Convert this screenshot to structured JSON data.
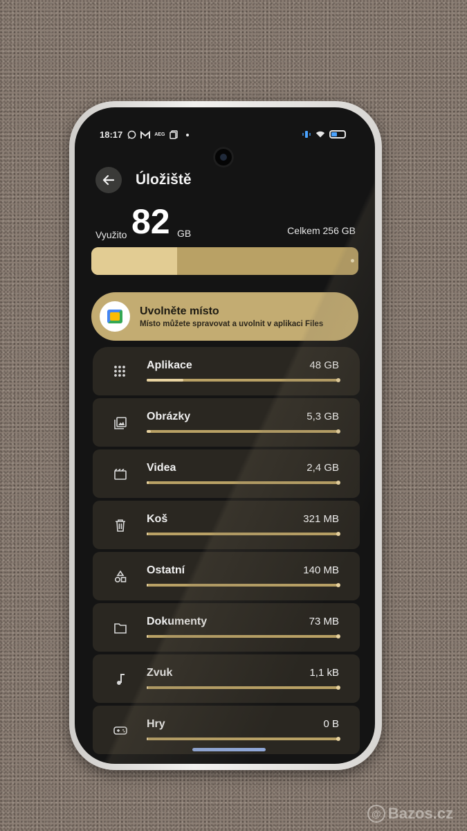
{
  "status_bar": {
    "time": "18:17",
    "left_icons": [
      "whatsapp-icon",
      "gmail-icon",
      "aeg-icon",
      "copy-icon",
      "dot-icon"
    ],
    "aeg_label": "AEG",
    "right_icons": [
      "vibrate-icon",
      "wifi-icon",
      "battery-icon"
    ]
  },
  "header": {
    "title": "Úložiště",
    "back_icon": "arrow-left-icon"
  },
  "storage": {
    "used_label": "Využito",
    "used_value": "82",
    "used_unit": "GB",
    "total_text": "Celkem 256 GB",
    "used_fraction": 0.32
  },
  "promo": {
    "title": "Uvolněte místo",
    "subtitle": "Místo můžete spravovat a uvolnit v aplikaci Files",
    "icon": "files-app-icon"
  },
  "categories": [
    {
      "name": "Aplikace",
      "size": "48 GB",
      "icon": "apps-grid-icon",
      "fraction": 0.19
    },
    {
      "name": "Obrázky",
      "size": "5,3 GB",
      "icon": "images-icon",
      "fraction": 0.02
    },
    {
      "name": "Videa",
      "size": "2,4 GB",
      "icon": "video-icon",
      "fraction": 0.01
    },
    {
      "name": "Koš",
      "size": "321 MB",
      "icon": "trash-icon",
      "fraction": 0.0
    },
    {
      "name": "Ostatní",
      "size": "140 MB",
      "icon": "shapes-icon",
      "fraction": 0.0
    },
    {
      "name": "Dokumenty",
      "size": "73 MB",
      "icon": "folder-icon",
      "fraction": 0.0
    },
    {
      "name": "Zvuk",
      "size": "1,1 kB",
      "icon": "music-note-icon",
      "fraction": 0.0
    },
    {
      "name": "Hry",
      "size": "0 B",
      "icon": "gamepad-icon",
      "fraction": 0.0
    }
  ],
  "watermark": {
    "text": "Bazos.cz"
  },
  "colors": {
    "accent": "#e2cc93",
    "track": "#b9a165",
    "promo_bg": "#c3ac72",
    "screen_bg": "#141414"
  }
}
